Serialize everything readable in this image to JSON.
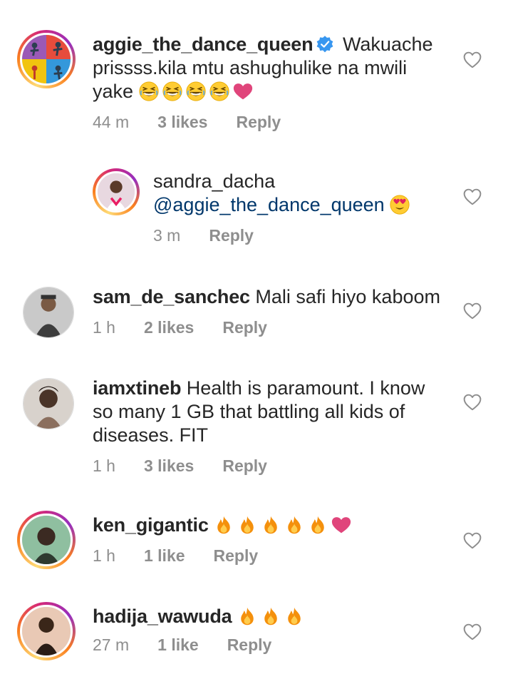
{
  "comments": [
    {
      "username": "aggie_the_dance_queen",
      "verified": true,
      "text": "Wakuache prissss.kila mtu ashughulike na mwili yake",
      "emojis": [
        "grinning-squint-icon",
        "grinning-squint-icon",
        "grinning-squint-icon",
        "grinning-squint-icon",
        "pink-heart-icon"
      ],
      "time": "44 m",
      "likes": "3 likes",
      "reply": "Reply"
    },
    {
      "username": "sandra_dacha",
      "mention": "@aggie_the_dance_queen",
      "emojis": [
        "heart-eyes-icon"
      ],
      "time": "3 m",
      "reply": "Reply"
    },
    {
      "username": "sam_de_sanchec",
      "text": "Mali safi hiyo kaboom",
      "time": "1 h",
      "likes": "2 likes",
      "reply": "Reply"
    },
    {
      "username": "iamxtineb",
      "text": "Health is paramount. I know so many 1 GB that battling all kids of diseases. FIT",
      "time": "1 h",
      "likes": "3 likes",
      "reply": "Reply"
    },
    {
      "username": "ken_gigantic",
      "emojis": [
        "fire-icon",
        "fire-icon",
        "fire-icon",
        "fire-icon",
        "fire-icon",
        "pink-heart-icon"
      ],
      "time": "1 h",
      "likes": "1 like",
      "reply": "Reply"
    },
    {
      "username": "hadija_wawuda",
      "emojis": [
        "fire-icon",
        "fire-icon",
        "fire-icon"
      ],
      "time": "27 m",
      "likes": "1 like",
      "reply": "Reply"
    }
  ],
  "colors": {
    "text": "#262626",
    "meta": "#8e8e8e",
    "mention": "#00376b",
    "verified": "#3897f0",
    "heart_outline": "#8e8e8e",
    "pink_heart": "#e0457b",
    "fire": "#f4900c"
  }
}
